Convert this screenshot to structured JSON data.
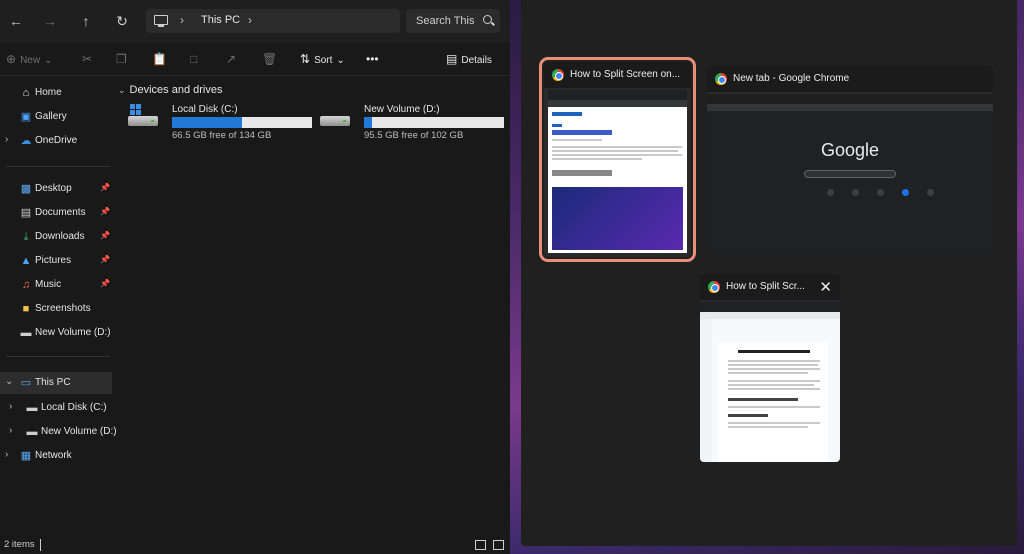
{
  "explorer": {
    "address": {
      "location": "This PC"
    },
    "search": {
      "placeholder": "Search This"
    },
    "commands": {
      "new_label": "New",
      "sort_label": "Sort",
      "details_label": "Details",
      "more_label": "•••"
    },
    "sidebar": {
      "quick": [
        {
          "label": "Home",
          "icon": "home-icon"
        },
        {
          "label": "Gallery",
          "icon": "gallery-icon"
        },
        {
          "label": "OneDrive",
          "icon": "cloud-icon"
        }
      ],
      "pinned": [
        {
          "label": "Desktop",
          "icon": "desktop-icon"
        },
        {
          "label": "Documents",
          "icon": "documents-icon"
        },
        {
          "label": "Downloads",
          "icon": "downloads-icon"
        },
        {
          "label": "Pictures",
          "icon": "pictures-icon"
        },
        {
          "label": "Music",
          "icon": "music-icon"
        },
        {
          "label": "Screenshots",
          "icon": "folder-icon"
        },
        {
          "label": "New Volume (D:)",
          "icon": "drive-icon"
        }
      ],
      "tree": [
        {
          "label": "This PC",
          "icon": "pc-icon",
          "selected": true
        },
        {
          "label": "Local Disk (C:)",
          "icon": "drive-icon"
        },
        {
          "label": "New Volume (D:)",
          "icon": "drive-icon"
        },
        {
          "label": "Network",
          "icon": "network-icon"
        }
      ]
    },
    "main": {
      "group_title": "Devices and drives",
      "drives": [
        {
          "name": "Local Disk (C:)",
          "free_text": "66.5 GB free of 134 GB",
          "used_fraction": 0.5
        },
        {
          "name": "New Volume (D:)",
          "free_text": "95.5 GB free of 102 GB",
          "used_fraction": 0.06
        }
      ]
    },
    "status": {
      "item_count": "2 items"
    }
  },
  "snap": {
    "windows": [
      {
        "title": "How to Split Screen on...",
        "focused": true,
        "page": "article"
      },
      {
        "title": "New tab - Google Chrome",
        "focused": false,
        "page": "google",
        "logo_text": "Google"
      },
      {
        "title": "How to Split Scr...",
        "focused": false,
        "page": "doc",
        "close_label": "✕"
      }
    ]
  },
  "colors": {
    "accent": "#2379d6",
    "focus_ring": "#e88e7a",
    "explorer_bg": "#191919"
  }
}
